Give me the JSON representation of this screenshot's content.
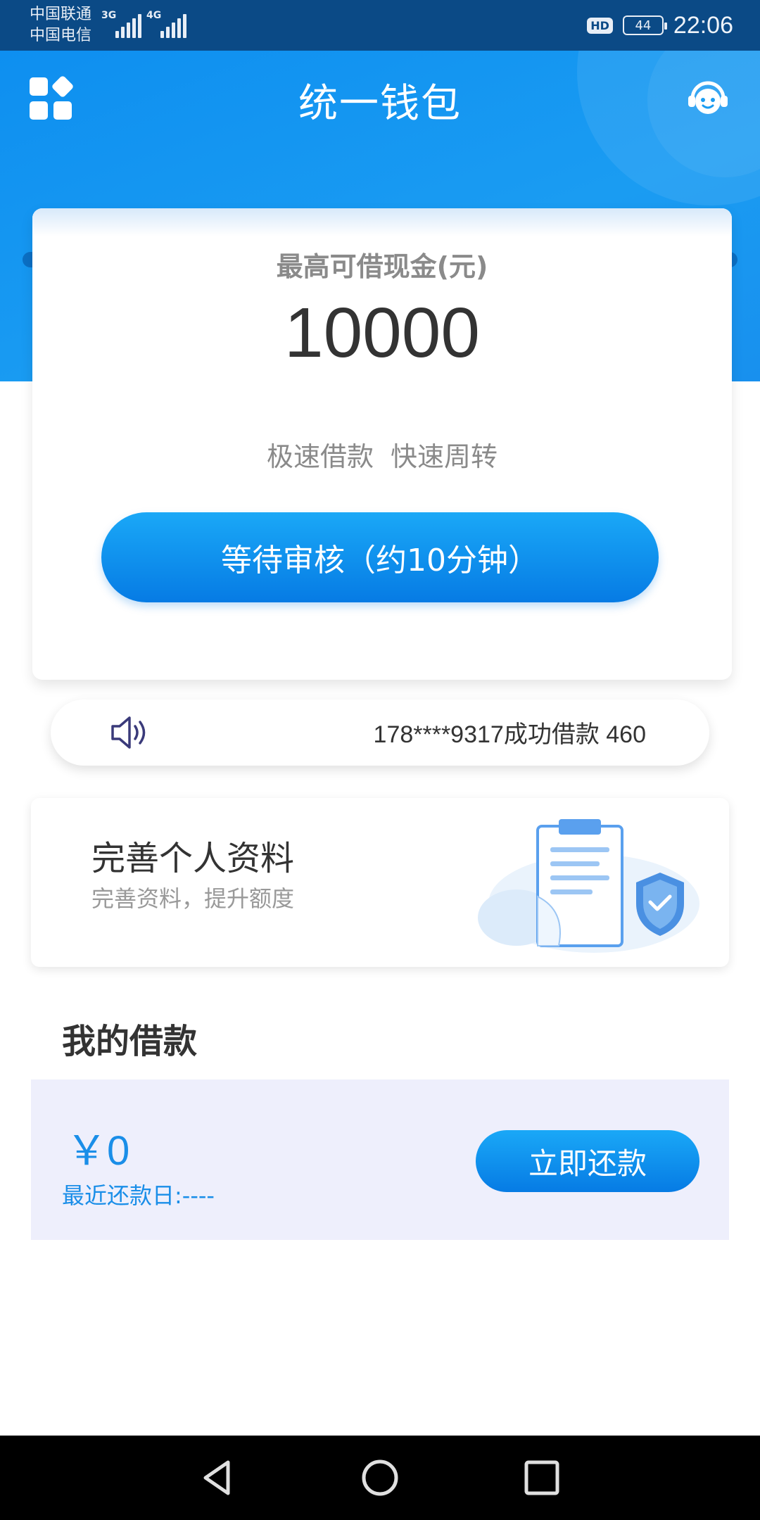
{
  "status_bar": {
    "carrier_1": "中国联通",
    "carrier_2": "中国电信",
    "network_1": "3G",
    "network_2": "4G",
    "hd": "HD",
    "battery": "44",
    "time": "22:06"
  },
  "header": {
    "title": "统一钱包",
    "menu_icon": "grid-icon",
    "support_icon": "customer-service-icon"
  },
  "credit_card": {
    "label": "最高可借现金(元)",
    "amount": "10000",
    "slogan_1": "极速借款",
    "slogan_2": "快速周转",
    "button_label": "等待审核（约10分钟）"
  },
  "notice": {
    "icon": "speaker-icon",
    "text": "178****9317成功借款 460"
  },
  "profile_card": {
    "title": "完善个人资料",
    "subtitle": "完善资料，提升额度",
    "illustration": "clipboard-shield-icon"
  },
  "my_loans": {
    "title": "我的借款",
    "amount": "￥0",
    "repay_date": "最近还款日:----",
    "repay_button": "立即还款"
  },
  "colors": {
    "primary": "#0e8ff0",
    "button": "#067be4",
    "panel": "#eeeffc",
    "accent_text": "#1a8ee8"
  }
}
